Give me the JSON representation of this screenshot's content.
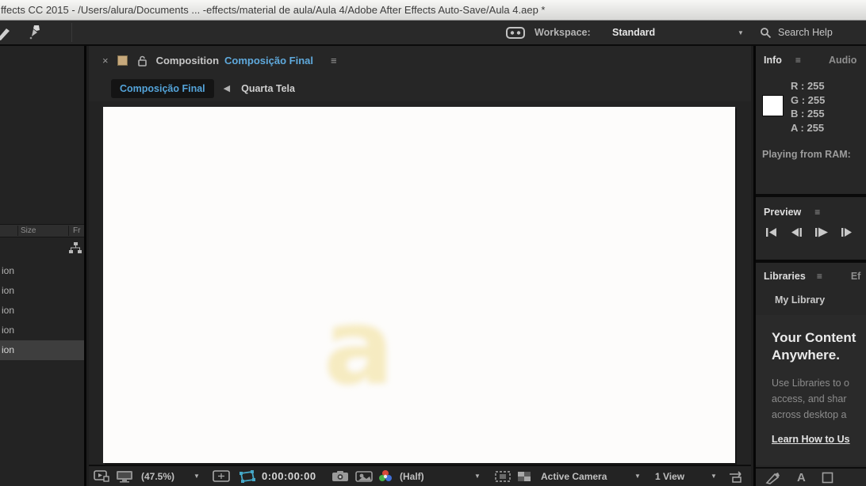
{
  "window": {
    "title": "ffects CC 2015 - /Users/alura/Documents ... -effects/material de aula/Aula 4/Adobe After Effects Auto-Save/Aula 4.aep *"
  },
  "toolbar": {
    "workspace_label": "Workspace:",
    "workspace_value": "Standard",
    "search_label": "Search Help"
  },
  "glyphs": {
    "menu": "≡",
    "close": "×",
    "back": "◀",
    "dropdown": "▼",
    "type_a": "A"
  },
  "project_panel": {
    "col_size": "Size",
    "col_fr": "Fr",
    "rows": [
      "ion",
      "ion",
      "ion",
      "ion",
      "ion"
    ]
  },
  "comp_panel": {
    "tab_prefix": "Composition",
    "tab_name": "Composição Final",
    "breadcrumb_current": "Composição Final",
    "breadcrumb_parent": "Quarta Tela",
    "viewer_letter": "a"
  },
  "comp_toolbar": {
    "zoom": "(47.5%)",
    "timecode": "0:00:00:00",
    "resolution": "(Half)",
    "camera": "Active Camera",
    "view": "1 View"
  },
  "info_panel": {
    "tab": "Info",
    "tab_audio": "Audio",
    "r": "R : 255",
    "g": "G : 255",
    "b": "B : 255",
    "a": "A : 255",
    "status": "Playing from RAM:"
  },
  "preview_panel": {
    "title": "Preview"
  },
  "libraries_panel": {
    "title": "Libraries",
    "tab2": "Ef",
    "library_selector": "My Library",
    "heading1": "Your Content",
    "heading2": "Anywhere.",
    "body1": "Use Libraries to o",
    "body2": "access, and shar",
    "body3": "across desktop a",
    "link": "Learn How to Us"
  },
  "colors": {
    "accent_blue": "#5fa9dc",
    "mask_cyan": "#45a8c8",
    "comp_thumb_tan": "#c7a97c",
    "letter_yellow": "#f2e09c",
    "swatch_white": "#ffffff"
  }
}
